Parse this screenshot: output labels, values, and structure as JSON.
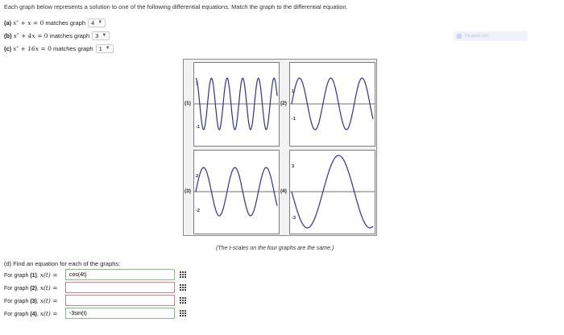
{
  "instructions": "Each graph below represents a solution to one of the following differential equations. Match the graph to the differential equation.",
  "questions": [
    {
      "label": "(a)",
      "lhs": "x″ + x",
      "rhs": "= 0",
      "suffix": "matches graph",
      "selected": "4"
    },
    {
      "label": "(b)",
      "lhs": "x″ + 4x",
      "rhs": "= 0",
      "suffix": "matches graph",
      "selected": "3"
    },
    {
      "label": "(c)",
      "lhs": "x″ + 16x",
      "rhs": "= 0",
      "suffix": "matches graph",
      "selected": "1"
    }
  ],
  "nav_pill_text": "Navigate info",
  "graphs": [
    {
      "label": "(1)",
      "top_tick": "1",
      "bottom_tick": "-1",
      "function": "cos(4t)",
      "amplitude": 1
    },
    {
      "label": "(2)",
      "top_tick": "1",
      "bottom_tick": "-1",
      "function": "sin(2t)",
      "amplitude": 1
    },
    {
      "label": "(3)",
      "top_tick": "2",
      "bottom_tick": "-2",
      "function": "2sin(2t)",
      "amplitude": 2
    },
    {
      "label": "(4)",
      "top_tick": "3",
      "bottom_tick": "-3",
      "function": "-3sin(t)",
      "amplitude": 3
    }
  ],
  "caption": "(The t-scales on the four graphs are the same.)",
  "part_d": {
    "title": "(d) Find an equation for each of the graphs:",
    "rows": [
      {
        "prefix": "For graph",
        "num": "(1)",
        "var": "x(t) =",
        "value": "cos(4t)",
        "status": "ok"
      },
      {
        "prefix": "For graph",
        "num": "(2)",
        "var": "x(t) =",
        "value": "",
        "status": "bad"
      },
      {
        "prefix": "For graph",
        "num": "(3)",
        "var": "x(t) =",
        "value": "",
        "status": "bad"
      },
      {
        "prefix": "For graph",
        "num": "(4)",
        "var": "x(t) =",
        "value": "-3sin(t)",
        "status": "ok"
      }
    ]
  },
  "colors": {
    "curve": "#2d2fa0",
    "axis": "#444444",
    "ok_border": "#7cc27c",
    "bad_border": "#e07b86"
  }
}
